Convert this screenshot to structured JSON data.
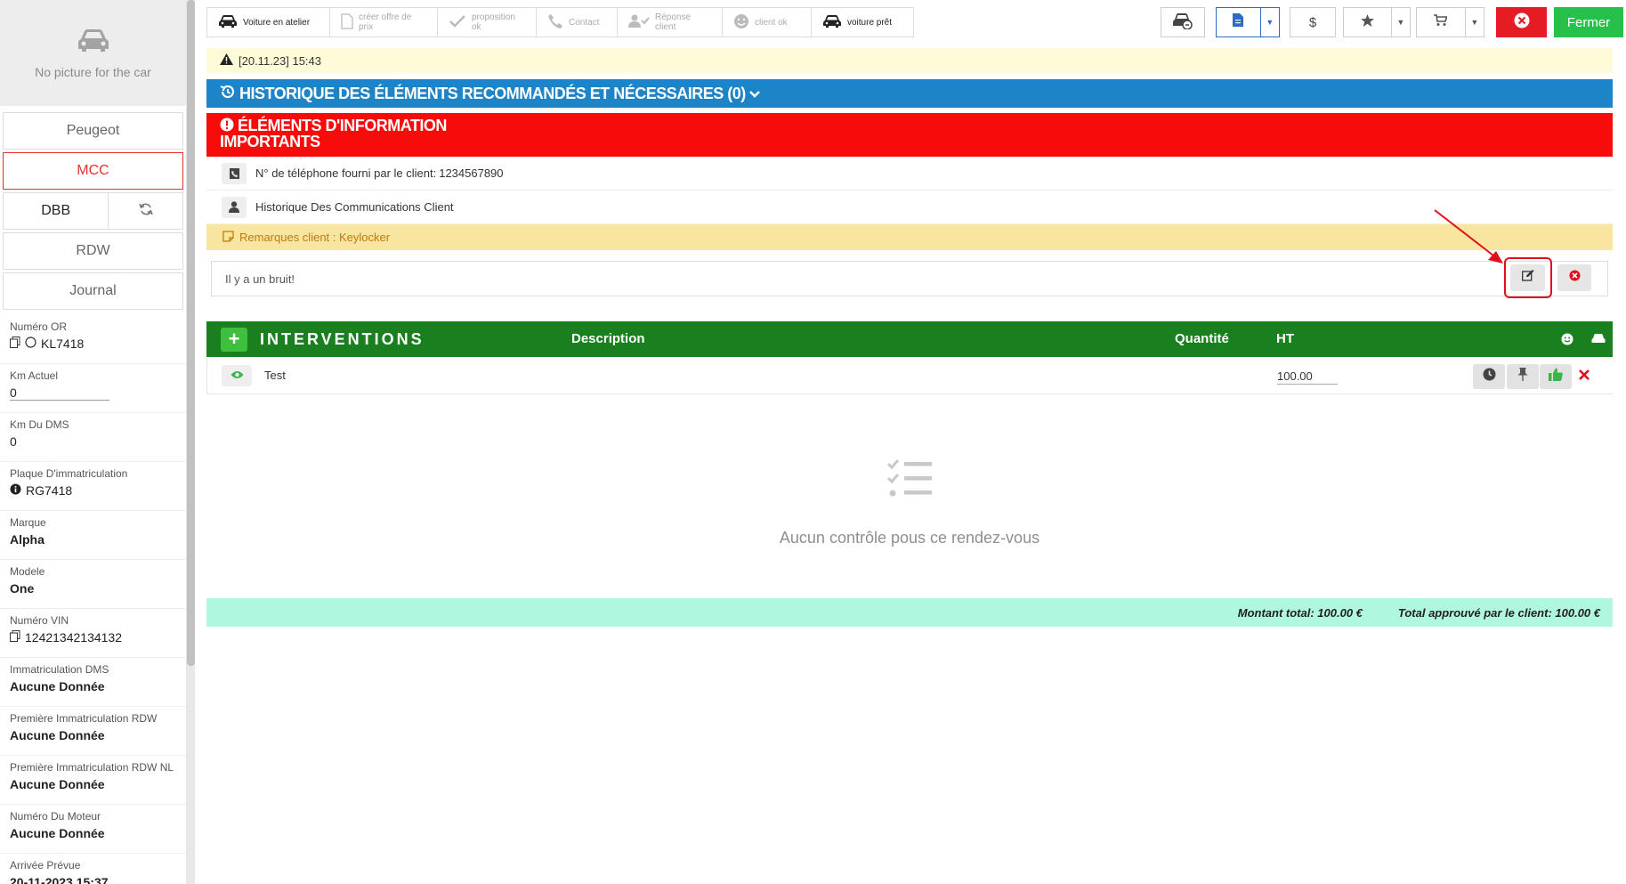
{
  "sidebar": {
    "no_picture": "No picture for the car",
    "buttons": {
      "peugeot": "Peugeot",
      "mcc": "MCC",
      "dbb": "DBB",
      "rdw": "RDW",
      "journal": "Journal"
    },
    "fields": [
      {
        "label": "Numéro OR",
        "value": "KL7418"
      },
      {
        "label": "Km Actuel",
        "value": "0"
      },
      {
        "label": "Km Du DMS",
        "value": "0"
      },
      {
        "label": "Plaque D'immatriculation",
        "value": "RG7418"
      },
      {
        "label": "Marque",
        "value": "Alpha"
      },
      {
        "label": "Modele",
        "value": "One"
      },
      {
        "label": "Numéro VIN",
        "value": "12421342134132"
      },
      {
        "label": "Immatriculation DMS",
        "value": "Aucune Donnée"
      },
      {
        "label": "Première Immatriculation RDW",
        "value": "Aucune Donnée"
      },
      {
        "label": "Première Immatriculation RDW NL",
        "value": "Aucune Donnée"
      },
      {
        "label": "Numéro Du Moteur",
        "value": "Aucune Donnée"
      },
      {
        "label": "Arrivée Prévue",
        "value": "20-11-2023 15:37"
      }
    ]
  },
  "steps": [
    {
      "label": "Voiture en atelier",
      "icon": "car-icon",
      "active": true
    },
    {
      "label": "créer offre de prix",
      "icon": "document-icon",
      "active": false
    },
    {
      "label": "proposition ok",
      "icon": "check-icon",
      "active": false
    },
    {
      "label": "Contact",
      "icon": "phone-icon",
      "active": false
    },
    {
      "label": "Réponse client",
      "icon": "user-check-icon",
      "active": false
    },
    {
      "label": "client ok",
      "icon": "smile-icon",
      "active": false
    },
    {
      "label": "voiture prêt",
      "icon": "car-icon",
      "active": true
    }
  ],
  "toolbar": {
    "dollar": "$",
    "close_label": "Fermer",
    "colors": {
      "close": "#e51c23",
      "fermer": "#27c04a",
      "doc_border": "#2b6cc4"
    }
  },
  "alert": {
    "text": "[20.11.23] 15:43"
  },
  "history": {
    "title": "HISTORIQUE DES ÉLÉMENTS RECOMMANDÉS ET NÉCESSAIRES (0)"
  },
  "important": {
    "title_line1": "ÉLÉMENTS D'INFORMATION",
    "title_line2": "IMPORTANTS"
  },
  "info": {
    "phone_label": "N° de téléphone fourni par le client:",
    "phone_value": "1234567890",
    "history_comm": "Historique Des Communications Client"
  },
  "remarks": {
    "label": "Remarques client : Keylocker",
    "text": "Il y a un bruit!"
  },
  "interventions": {
    "title": "INTERVENTIONS",
    "col_description": "Description",
    "col_quantity": "Quantité",
    "col_ht": "HT",
    "rows": [
      {
        "name": "Test",
        "ht": "100.00"
      }
    ]
  },
  "empty": {
    "text": "Aucun contrôle pous ce rendez-vous"
  },
  "totals": {
    "montant": "Montant total: 100.00 €",
    "approved": "Total approuvé par le client: 100.00 €"
  }
}
